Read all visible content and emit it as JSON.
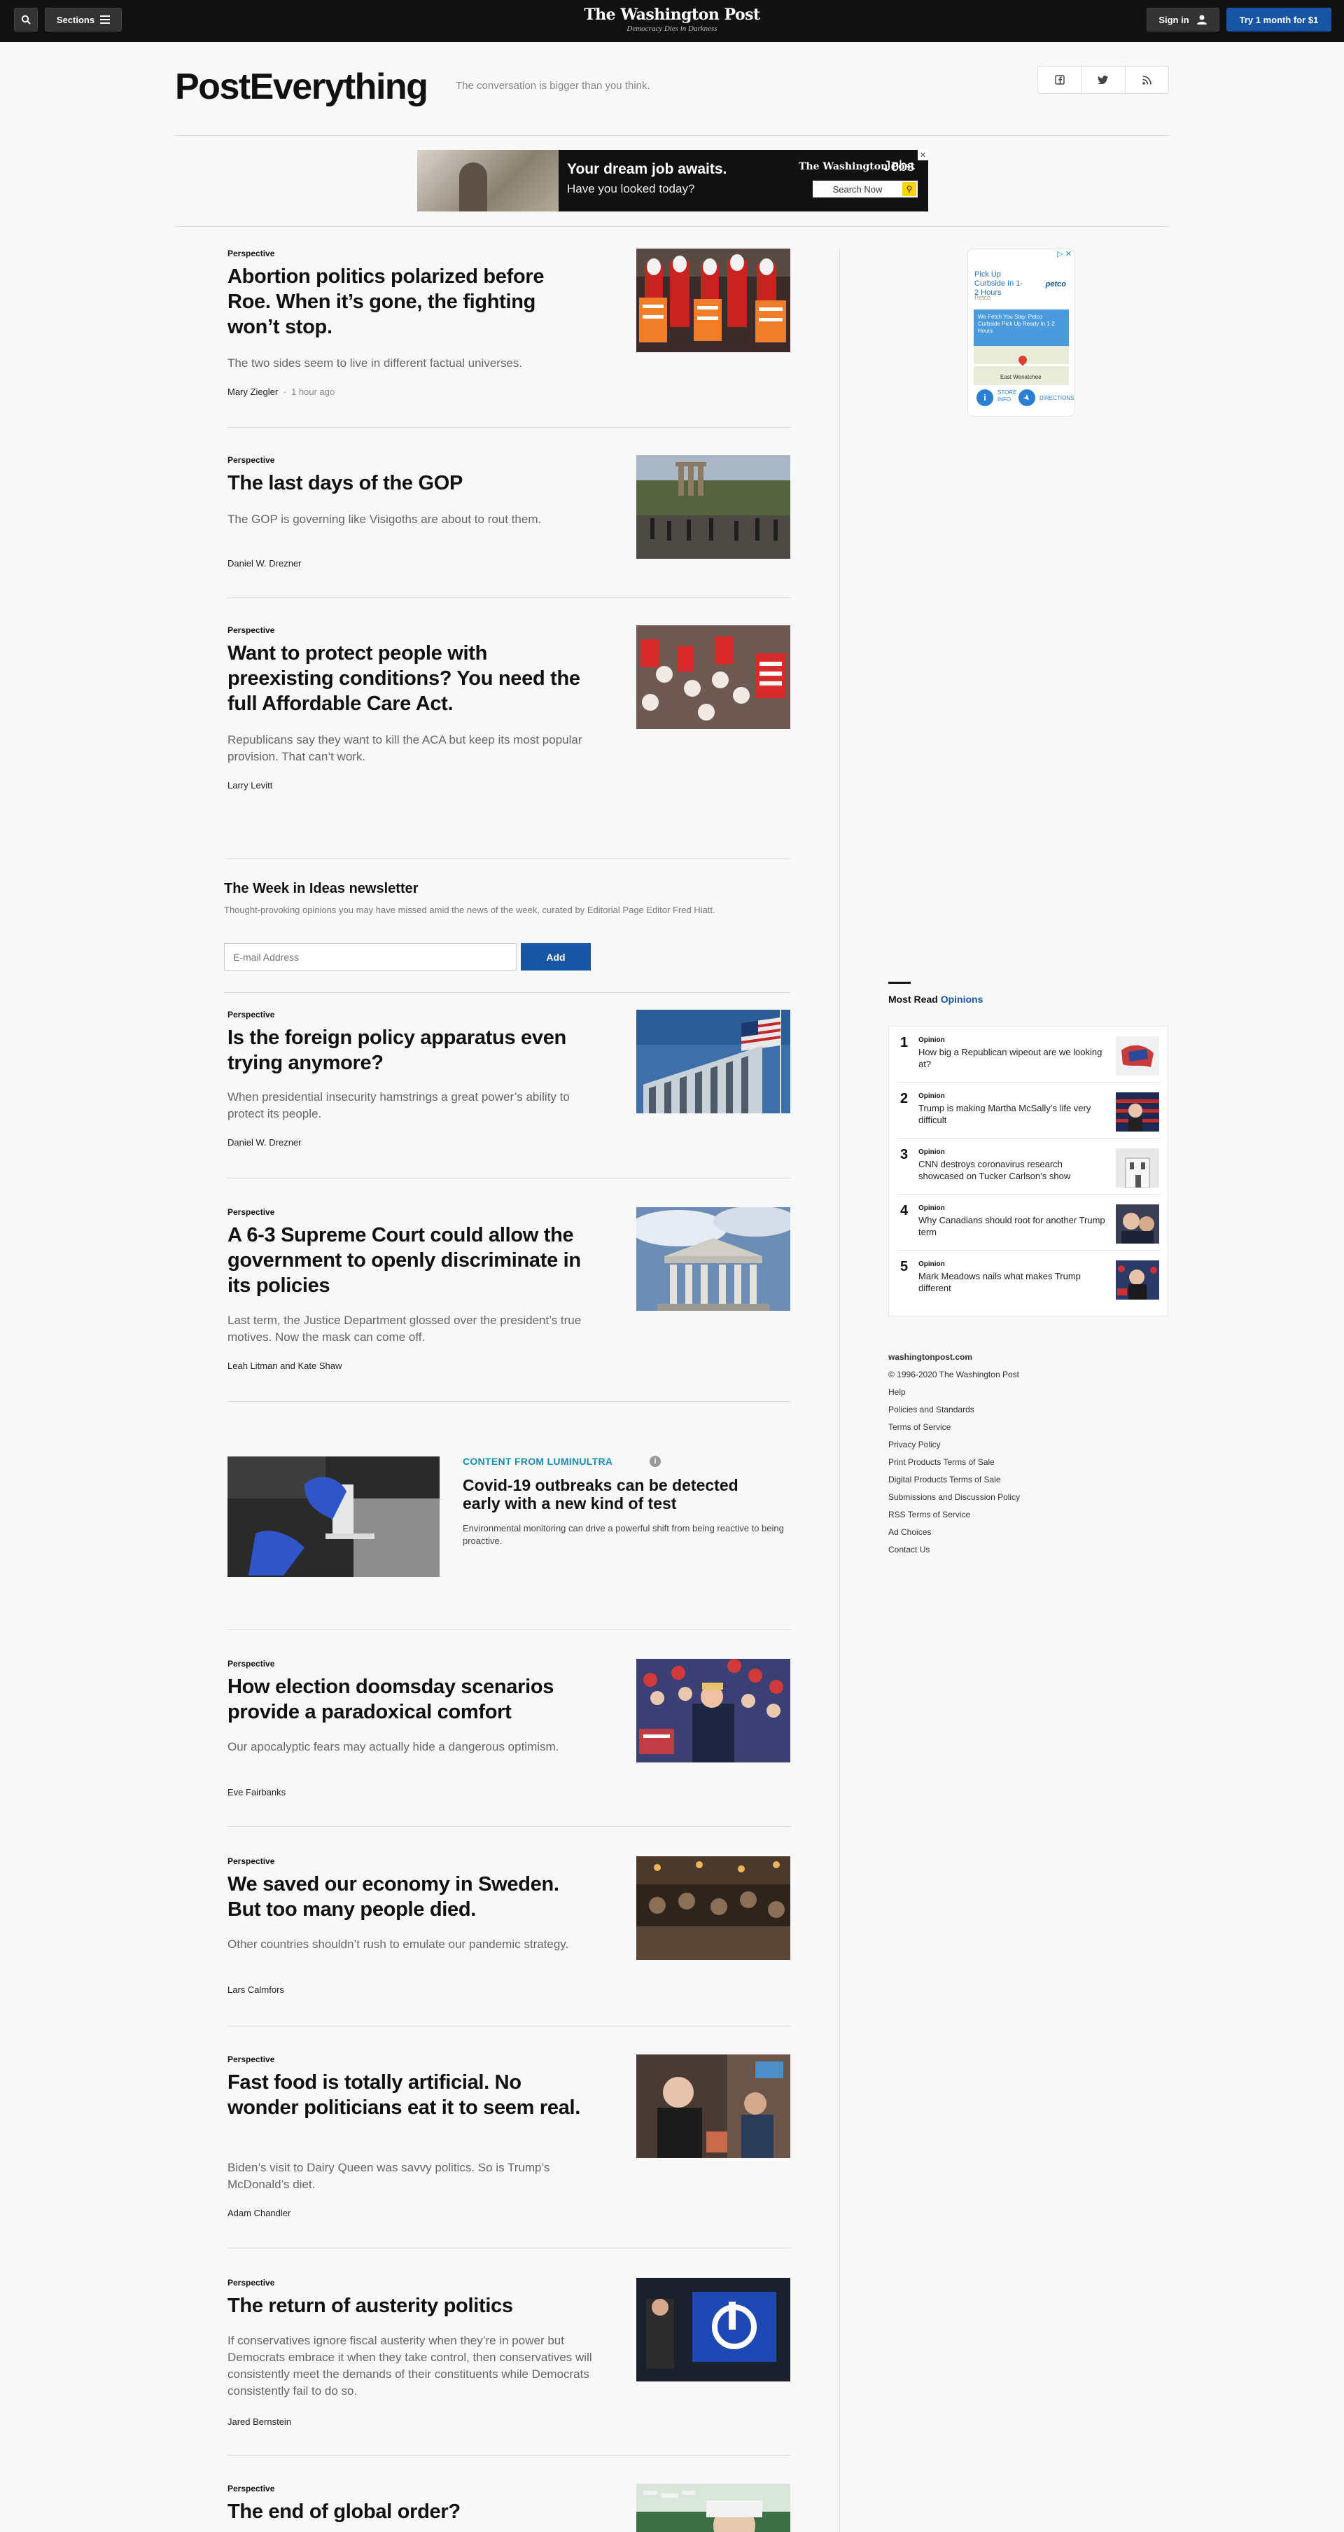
{
  "topnav": {
    "sections_label": "Sections",
    "masthead_name": "The Washington Post",
    "masthead_tagline": "Democracy Dies in Darkness",
    "signin_label": "Sign in",
    "subscribe_label": "Try 1 month for $1"
  },
  "header": {
    "title": "PostEverything",
    "tagline": "The conversation is bigger than you think."
  },
  "ad_banner": {
    "headline": "Your dream job awaits.",
    "subhead": "Have you looked today?",
    "brand": "The Washington Post",
    "brand_section": "Jobs",
    "search_label": "Search Now"
  },
  "articles": [
    {
      "label": "Perspective",
      "headline": "Abortion politics polarized before Roe. When it’s gone, the fighting won’t stop.",
      "blurb": "The two sides seem to live in different factual universes.",
      "byline": "Mary Ziegler",
      "time": "1 hour ago"
    },
    {
      "label": "Perspective",
      "headline": "The last days of the GOP",
      "blurb": "The GOP is governing like Visigoths are about to rout them.",
      "byline": "Daniel W. Drezner"
    },
    {
      "label": "Perspective",
      "headline": "Want to protect people with preexisting conditions? You need the full Affordable Care Act.",
      "blurb": "Republicans say they want to kill the ACA but keep its most popular provision. That can’t work.",
      "byline": "Larry Levitt"
    },
    {
      "label": "Perspective",
      "headline": "Is the foreign policy apparatus even trying anymore?",
      "blurb": "When presidential insecurity hamstrings a great power’s ability to protect its people.",
      "byline": "Daniel W. Drezner"
    },
    {
      "label": "Perspective",
      "headline": "A 6-3 Supreme Court could allow the government to openly discriminate in its policies",
      "blurb": "Last term, the Justice Department glossed over the president’s true motives. Now the mask can come off.",
      "byline": "Leah Litman and Kate Shaw"
    },
    {
      "label": "Perspective",
      "headline": "How election doomsday scenarios provide a paradoxical comfort",
      "blurb": "Our apocalyptic fears may actually hide a dangerous optimism.",
      "byline": "Eve Fairbanks"
    },
    {
      "label": "Perspective",
      "headline": "We saved our economy in Sweden. But too many people died.",
      "blurb": "Other countries shouldn’t rush to emulate our pandemic strategy.",
      "byline": "Lars Calmfors"
    },
    {
      "label": "Perspective",
      "headline": "Fast food is totally artificial. No wonder politicians eat it to seem real.",
      "blurb": "Biden’s visit to Dairy Queen was savvy politics. So is Trump’s McDonald’s diet.",
      "byline": "Adam Chandler"
    },
    {
      "label": "Perspective",
      "headline": "The return of austerity politics",
      "blurb": "If conservatives ignore fiscal austerity when they’re in power but Democrats embrace it when they take control, then conservatives will consistently meet the demands of their constituents while Democrats consistently fail to do so.",
      "byline": "Jared Bernstein"
    },
    {
      "label": "Perspective",
      "headline": "The end of global order?"
    }
  ],
  "newsletter": {
    "title": "The Week in Ideas newsletter",
    "description": "Thought-provoking opinions you may have missed amid the news of the week, curated by Editorial Page Editor Fred Hiatt.",
    "placeholder": "E-mail Address",
    "button": "Add"
  },
  "sponsored": {
    "label": "CONTENT FROM LUMINULTRA",
    "headline": "Covid-19 outbreaks can be detected early with a new kind of test",
    "blurb": "Environmental monitoring can drive a powerful shift from being reactive to being proactive."
  },
  "rail_ad": {
    "title": "Pick Up Curbside In 1-2 Hours",
    "brand": "petco",
    "advertiser": "Petco",
    "promo": "We Fetch You Stay. Petco Curbside Pick Up Ready In 1-2 Hours",
    "map_label": "East Wenatchee",
    "store_info": "STORE INFO",
    "directions": "DIRECTIONS"
  },
  "most_read": {
    "title": "Most Read",
    "title_section": "Opinions",
    "items": [
      {
        "rank": "1",
        "label": "Opinion",
        "text": "How big a Republican wipeout are we looking at?"
      },
      {
        "rank": "2",
        "label": "Opinion",
        "text": "Trump is making Martha McSally’s life very difficult"
      },
      {
        "rank": "3",
        "label": "Opinion",
        "text": "CNN destroys coronavirus research showcased on Tucker Carlson’s show"
      },
      {
        "rank": "4",
        "label": "Opinion",
        "text": "Why Canadians should root for another Trump term"
      },
      {
        "rank": "5",
        "label": "Opinion",
        "text": "Mark Meadows nails what makes Trump different"
      }
    ]
  },
  "footer": {
    "site": "washingtonpost.com",
    "copyright": "© 1996-2020 The Washington Post",
    "links": [
      "Help",
      "Policies and Standards",
      "Terms of Service",
      "Privacy Policy",
      "Print Products Terms of Sale",
      "Digital Products Terms of Sale",
      "Submissions and Discussion Policy",
      "RSS Terms of Service",
      "Ad Choices",
      "Contact Us"
    ]
  },
  "colors": {
    "accent": "#1955a5",
    "sponsored_label": "#1a8cb0",
    "topbar": "#111111"
  }
}
